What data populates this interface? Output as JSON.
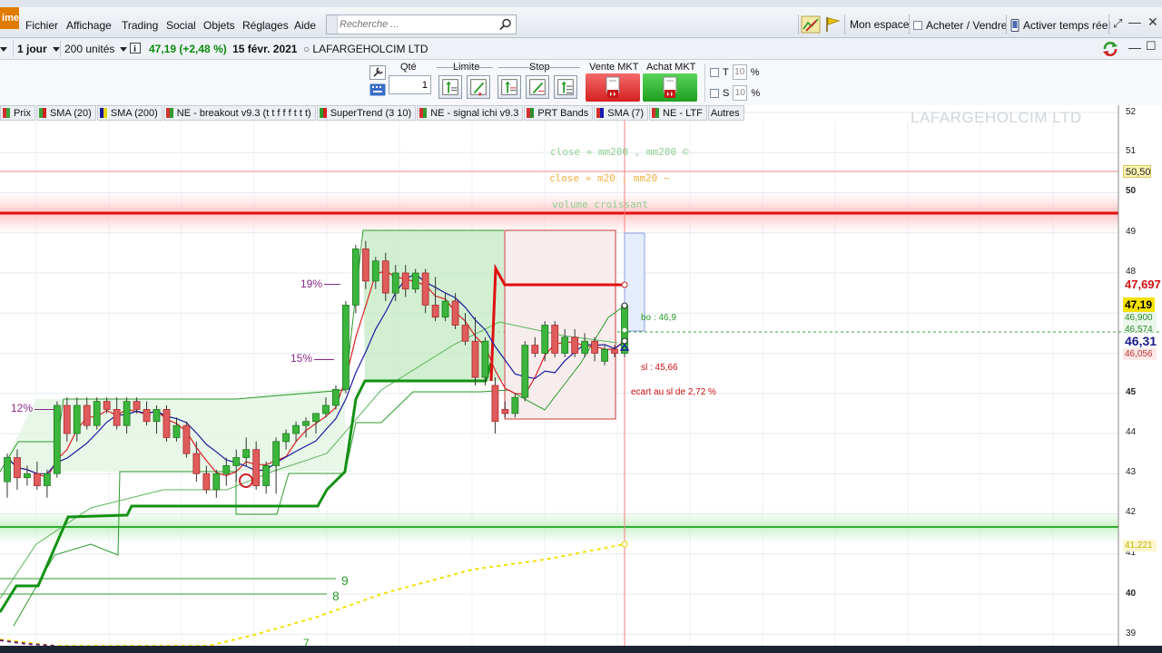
{
  "app": {
    "logo_text": "ime",
    "menu": [
      "Fichier",
      "Affichage",
      "Trading",
      "Social",
      "Objets",
      "Réglages",
      "Aide"
    ],
    "search_placeholder": "Recherche ...",
    "right_buttons": {
      "mon_espace": "Mon espace",
      "acheter_vendre": "Acheter / Vendre",
      "temps_reel": "Activer temps réel"
    }
  },
  "toolbar": {
    "period": "1 jour",
    "units": "200 unités",
    "last_price": "47,19",
    "change": "(+2,48 %)",
    "date": "15 févr. 2021",
    "instrument": "LAFARGEHOLCIM LTD"
  },
  "order": {
    "qty_label": "Qté",
    "qty_value": "1",
    "limit_label": "Limite",
    "stop_label": "Stop",
    "sell_mkt": "Vente MKT",
    "buy_mkt": "Achat MKT",
    "t_label": "T",
    "s_label": "S",
    "t_value": "10",
    "s_value": "10",
    "percent": "%"
  },
  "indicators": [
    {
      "label": "Prix",
      "color": "#3aa23a"
    },
    {
      "label": "SMA (20)",
      "color": "#cc2222"
    },
    {
      "label": "SMA (200)",
      "color": "#e8d400"
    },
    {
      "label": "NE - breakout v9.3 (t t f f f t t t)",
      "color": "#2f9a2f"
    },
    {
      "label": "SuperTrend (3 10)",
      "color": "#d42020"
    },
    {
      "label": "NE - signal ichi v9.3",
      "color": "#2f9a2f"
    },
    {
      "label": "PRT Bands",
      "color": "#2e8f2e"
    },
    {
      "label": "SMA (7)",
      "color": "#1a1ab0"
    },
    {
      "label": "NE - LTF",
      "color": "#2f9a2f"
    },
    {
      "label": "Autres",
      "color": ""
    }
  ],
  "chart": {
    "watermark": "LAFARGEHOLCIM LTD",
    "notes": {
      "line1": "close » mm200 , mm200 ©",
      "line2": "close » m20 , mm20 ~",
      "line3": "volume croissant"
    },
    "pct_labels": [
      "19%",
      "15%",
      "12%"
    ],
    "bo_label": "bo : 46,9",
    "sl_label": "sl : 45,66",
    "ecart_label": "ecart au sl de 2,72 %",
    "wave_labels": [
      "9",
      "8",
      "7"
    ],
    "y_ticks": [
      "52",
      "51",
      "50",
      "49",
      "48",
      "45",
      "44",
      "43",
      "42",
      "41",
      "40",
      "39"
    ],
    "price_tags": [
      {
        "label": "50,50",
        "bg": "#fbf3b0",
        "color": "#222"
      },
      {
        "label": "47,697",
        "bg": "#ffffff",
        "color": "#d01010"
      },
      {
        "label": "47,19",
        "bg": "#f6e200",
        "color": "#000"
      },
      {
        "label": "46,900",
        "bg": "#eaf7ea",
        "color": "#2a8a2a"
      },
      {
        "label": "46,574",
        "bg": "#eaf7ea",
        "color": "#2a8a2a"
      },
      {
        "label": "46,31",
        "bg": "#ffffff",
        "color": "#1a1a8a"
      },
      {
        "label": "46,056",
        "bg": "#fbe8e8",
        "color": "#c03030"
      },
      {
        "label": "41,221",
        "bg": "#fbf6d0",
        "color": "#c8b300"
      }
    ]
  },
  "chart_data": {
    "type": "candlestick",
    "title": "LAFARGEHOLCIM LTD",
    "ylim": [
      39,
      52
    ],
    "candles": [
      [
        42.8,
        43.5,
        42.4,
        43.4
      ],
      [
        43.4,
        43.6,
        42.6,
        42.9
      ],
      [
        42.9,
        43.2,
        42.7,
        43.0
      ],
      [
        43.0,
        43.3,
        42.6,
        42.7
      ],
      [
        42.7,
        43.1,
        42.4,
        43.0
      ],
      [
        43.0,
        44.8,
        42.9,
        44.7
      ],
      [
        44.7,
        44.9,
        43.8,
        44.0
      ],
      [
        44.0,
        44.9,
        43.8,
        44.7
      ],
      [
        44.7,
        44.9,
        44.1,
        44.2
      ],
      [
        44.2,
        44.9,
        44.1,
        44.8
      ],
      [
        44.8,
        44.9,
        44.5,
        44.6
      ],
      [
        44.6,
        44.9,
        44.1,
        44.2
      ],
      [
        44.2,
        44.9,
        44.0,
        44.8
      ],
      [
        44.8,
        44.9,
        44.5,
        44.6
      ],
      [
        44.6,
        44.8,
        44.2,
        44.3
      ],
      [
        44.3,
        44.7,
        44.0,
        44.6
      ],
      [
        44.6,
        44.7,
        43.8,
        43.9
      ],
      [
        43.9,
        44.4,
        43.8,
        44.2
      ],
      [
        44.2,
        44.3,
        43.4,
        43.5
      ],
      [
        43.5,
        43.8,
        42.8,
        43.0
      ],
      [
        43.0,
        43.2,
        42.5,
        42.6
      ],
      [
        42.6,
        43.1,
        42.4,
        43.0
      ],
      [
        43.0,
        43.4,
        42.7,
        43.2
      ],
      [
        43.2,
        43.6,
        42.8,
        43.4
      ],
      [
        43.4,
        43.9,
        43.2,
        43.6
      ],
      [
        43.6,
        43.8,
        42.6,
        42.7
      ],
      [
        42.7,
        43.3,
        42.5,
        43.2
      ],
      [
        43.2,
        43.9,
        42.5,
        43.8
      ],
      [
        43.8,
        44.1,
        43.6,
        44.0
      ],
      [
        44.0,
        44.3,
        43.8,
        44.2
      ],
      [
        44.2,
        44.4,
        43.9,
        44.3
      ],
      [
        44.3,
        44.5,
        44.0,
        44.5
      ],
      [
        44.5,
        44.9,
        44.4,
        44.7
      ],
      [
        44.7,
        45.2,
        44.6,
        45.1
      ],
      [
        45.1,
        47.3,
        45.0,
        47.2
      ],
      [
        47.2,
        48.7,
        47.0,
        48.6
      ],
      [
        48.6,
        48.8,
        47.6,
        47.8
      ],
      [
        47.8,
        48.4,
        47.6,
        48.3
      ],
      [
        48.3,
        48.5,
        47.3,
        47.5
      ],
      [
        47.5,
        48.2,
        47.3,
        48.0
      ],
      [
        48.0,
        48.2,
        47.4,
        47.6
      ],
      [
        47.6,
        48.1,
        47.5,
        48.0
      ],
      [
        48.0,
        48.1,
        47.0,
        47.2
      ],
      [
        47.2,
        47.9,
        46.8,
        46.9
      ],
      [
        46.9,
        47.5,
        46.8,
        47.3
      ],
      [
        47.3,
        47.5,
        46.6,
        46.7
      ],
      [
        46.7,
        47.0,
        46.2,
        46.3
      ],
      [
        46.3,
        46.9,
        45.2,
        45.4
      ],
      [
        45.4,
        46.4,
        45.2,
        46.3
      ],
      [
        45.2,
        45.4,
        44.0,
        44.3
      ],
      [
        44.6,
        44.8,
        44.4,
        44.5
      ],
      [
        44.5,
        45.0,
        44.4,
        44.9
      ],
      [
        44.9,
        46.3,
        44.8,
        46.2
      ],
      [
        46.2,
        46.4,
        45.9,
        46.0
      ],
      [
        46.0,
        46.8,
        45.8,
        46.7
      ],
      [
        46.7,
        46.8,
        45.9,
        46.0
      ],
      [
        46.0,
        46.6,
        45.9,
        46.4
      ],
      [
        46.4,
        46.6,
        45.9,
        46.0
      ],
      [
        46.0,
        46.5,
        45.9,
        46.3
      ],
      [
        46.3,
        46.4,
        45.8,
        46.0
      ],
      [
        45.8,
        46.2,
        45.7,
        46.1
      ],
      [
        46.1,
        46.2,
        45.9,
        46.0
      ],
      [
        46.0,
        47.2,
        45.9,
        47.19
      ]
    ],
    "lines": {
      "sma_20_red": "SMA (20)",
      "supertrend": "SuperTrend (3 10)",
      "sma_200": "SMA (200)"
    },
    "levels": {
      "resistance": 49.5,
      "support": 41.6,
      "stop_line": 47.697,
      "bo": 46.9,
      "sl": 45.66
    }
  }
}
